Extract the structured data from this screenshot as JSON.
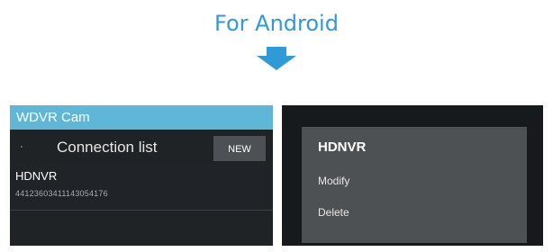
{
  "heading": {
    "title": "For Android",
    "arrow_icon": "arrow-down-icon",
    "accent_color": "#2e9ad6"
  },
  "left_screen": {
    "app_bar_title": "WDVR Cam",
    "list_title": "Connection list",
    "new_button_label": "NEW",
    "items": [
      {
        "name": "HDNVR",
        "id": "44123603411143054176"
      }
    ],
    "colors": {
      "app_bar": "#5fb7d8",
      "background": "#1f2326",
      "button": "#4d5156"
    }
  },
  "right_screen": {
    "menu_title": "HDNVR",
    "menu_items": [
      {
        "label": "Modify"
      },
      {
        "label": "Delete"
      }
    ],
    "colors": {
      "background": "#171a1c",
      "menu": "#4e5154"
    }
  }
}
